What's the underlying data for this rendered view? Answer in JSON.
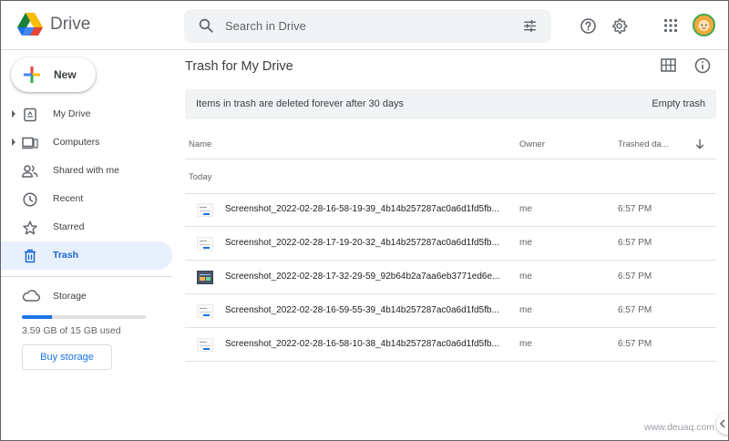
{
  "app": {
    "name": "Drive"
  },
  "search": {
    "placeholder": "Search in Drive"
  },
  "header_icons": [
    "search-icon",
    "tune-icon",
    "help-icon",
    "settings-icon",
    "apps-grid-icon",
    "avatar"
  ],
  "new_button": {
    "label": "New"
  },
  "sidebar": {
    "items": [
      {
        "label": "My Drive",
        "icon": "my-drive-icon",
        "expandable": true,
        "active": false
      },
      {
        "label": "Computers",
        "icon": "computers-icon",
        "expandable": true,
        "active": false
      },
      {
        "label": "Shared with me",
        "icon": "shared-icon",
        "expandable": false,
        "active": false
      },
      {
        "label": "Recent",
        "icon": "clock-icon",
        "expandable": false,
        "active": false
      },
      {
        "label": "Starred",
        "icon": "star-icon",
        "expandable": false,
        "active": false
      },
      {
        "label": "Trash",
        "icon": "trash-icon",
        "expandable": false,
        "active": true
      }
    ],
    "storage": {
      "label": "Storage",
      "used_text": "3.59 GB of 15 GB used",
      "used_fraction": 0.24,
      "buy_label": "Buy storage"
    }
  },
  "main": {
    "title": "Trash for My Drive",
    "banner": {
      "text": "Items in trash are deleted forever after 30 days",
      "action": "Empty trash"
    },
    "columns": {
      "name": "Name",
      "owner": "Owner",
      "trashed": "Trashed da..."
    },
    "group": "Today",
    "files": [
      {
        "name": "Screenshot_2022-02-28-16-58-19-39_4b14b257287ac0a6d1fd5fb...",
        "owner": "me",
        "trashed": "6:57 PM",
        "thumb": "light"
      },
      {
        "name": "Screenshot_2022-02-28-17-19-20-32_4b14b257287ac0a6d1fd5fb...",
        "owner": "me",
        "trashed": "6:57 PM",
        "thumb": "light"
      },
      {
        "name": "Screenshot_2022-02-28-17-32-29-59_92b64b2a7aa6eb3771ed6e...",
        "owner": "me",
        "trashed": "6:57 PM",
        "thumb": "dark"
      },
      {
        "name": "Screenshot_2022-02-28-16-59-55-39_4b14b257287ac0a6d1fd5fb...",
        "owner": "me",
        "trashed": "6:57 PM",
        "thumb": "light"
      },
      {
        "name": "Screenshot_2022-02-28-16-58-10-38_4b14b257287ac0a6d1fd5fb...",
        "owner": "me",
        "trashed": "6:57 PM",
        "thumb": "light"
      }
    ]
  },
  "watermark": "www.deuaq.com",
  "colors": {
    "accent": "#1a73e8",
    "active_bg": "#e8f0fe",
    "active_text": "#1967d2",
    "banner_bg": "#f1f3f4"
  }
}
